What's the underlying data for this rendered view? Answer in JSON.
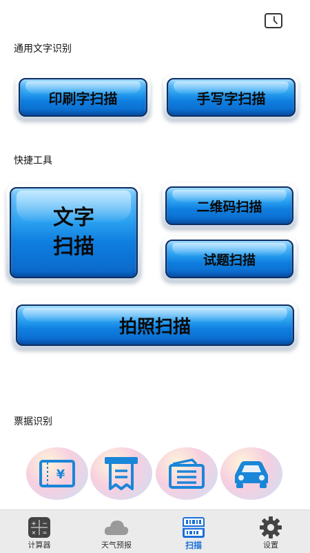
{
  "header": {
    "history_icon": "clock-icon"
  },
  "sections": {
    "ocr_label": "通用文字识别",
    "tools_label": "快捷工具",
    "tickets_label": "票据识别"
  },
  "ocr_buttons": {
    "print": "印刷字扫描",
    "handwriting": "手写字扫描"
  },
  "tools": {
    "text_scan_line1": "文字",
    "text_scan_line2": "扫描",
    "qr_scan": "二维码扫描",
    "question_scan": "试题扫描",
    "photo_scan": "拍照扫描"
  },
  "tickets": [
    {
      "icon": "ticket-icon",
      "name": "ticket"
    },
    {
      "icon": "receipt-icon",
      "name": "receipt"
    },
    {
      "icon": "card-icon",
      "name": "card"
    },
    {
      "icon": "car-icon",
      "name": "vehicle"
    }
  ],
  "tabs": [
    {
      "label": "计算器",
      "icon": "calculator-icon"
    },
    {
      "label": "天气预报",
      "icon": "cloud-icon"
    },
    {
      "label": "扫描",
      "icon": "scan-icon",
      "active": true
    },
    {
      "label": "设置",
      "icon": "gear-icon"
    }
  ],
  "colors": {
    "button_blue": "#1a8be8",
    "border_navy": "#0c2d63",
    "active_tab": "#1a6fd8",
    "tabbar_bg": "#ebebeb"
  }
}
